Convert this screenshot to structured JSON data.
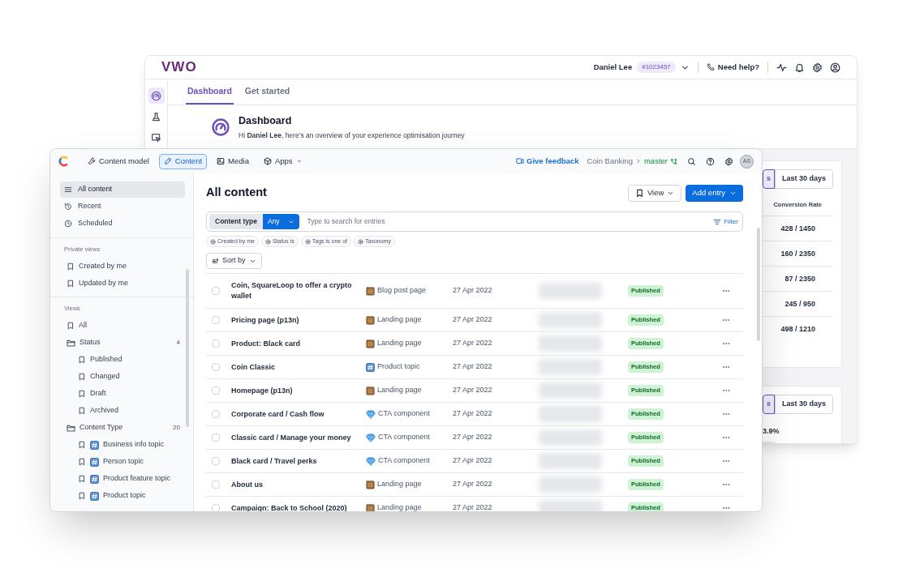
{
  "back_window": {
    "logo": "VWO",
    "header": {
      "user_name": "Daniel Lee",
      "account_id": "#1023457",
      "help": "Need help?"
    },
    "rail_items": [
      {
        "selected": true
      },
      {
        "selected": false
      },
      {
        "selected": false
      }
    ],
    "tabs": [
      {
        "label": "Dashboard",
        "selected": true
      },
      {
        "label": "Get started",
        "selected": false
      }
    ],
    "page_header": {
      "title": "Dashboard",
      "subtitle": "Hi **Daniel Lee**, here’s an overview of your experience optimisation journey"
    },
    "cards": [
      {
        "range_tabs": [
          {
            "label": "s",
            "selected": true
          },
          {
            "label": "Last 30 days",
            "selected": false
          }
        ],
        "column_header": "Conversion Rate",
        "values": [
          "428 / 1450",
          "160 / 2350",
          "87 / 2350",
          "245 / 950",
          "498 / 1210"
        ]
      },
      {
        "range_tabs": [
          {
            "label": "s",
            "selected": true
          },
          {
            "label": "Last 30 days",
            "selected": false
          }
        ],
        "values": [
          "3.9%"
        ]
      }
    ]
  },
  "front_window": {
    "nav": [
      {
        "label": "Content model",
        "selected": false,
        "has_menu": false
      },
      {
        "label": "Content",
        "selected": true,
        "has_menu": false
      },
      {
        "label": "Media",
        "selected": false,
        "has_menu": false
      },
      {
        "label": "Apps",
        "selected": false,
        "has_menu": true
      }
    ],
    "feedback": "Give feedback",
    "space": "Coin Banking",
    "environment": "master",
    "avatar_initials": "AS",
    "sidebar": {
      "top_items": [
        {
          "label": "All content",
          "selected": true
        },
        {
          "label": "Recent",
          "selected": false
        },
        {
          "label": "Scheduled",
          "selected": false
        }
      ],
      "sections": [
        {
          "heading": "Private views",
          "items": [
            {
              "label": "Created by me",
              "kind": "view"
            },
            {
              "label": "Updated by me",
              "kind": "view"
            }
          ]
        },
        {
          "heading": "Views",
          "items": [
            {
              "label": "All",
              "kind": "view"
            },
            {
              "label": "Status",
              "kind": "folder",
              "count": "4",
              "children": [
                {
                  "label": "Published",
                  "kind": "view"
                },
                {
                  "label": "Changed",
                  "kind": "view"
                },
                {
                  "label": "Draft",
                  "kind": "view"
                },
                {
                  "label": "Archived",
                  "kind": "view"
                }
              ]
            },
            {
              "label": "Content Type",
              "kind": "folder",
              "count": "20",
              "children": [
                {
                  "label": "Business info topic",
                  "kind": "type_view"
                },
                {
                  "label": "Person topic",
                  "kind": "type_view"
                },
                {
                  "label": "Product feature topic",
                  "kind": "type_view"
                },
                {
                  "label": "Product topic",
                  "kind": "type_view"
                }
              ]
            }
          ]
        }
      ]
    },
    "main": {
      "title": "All content",
      "view_button": "View",
      "add_button": "Add entry",
      "search": {
        "filter_label": "Content type",
        "filter_value": "Any",
        "placeholder": "Type to search for entries",
        "filter_button": "Filter"
      },
      "chips": [
        "Created by me",
        "Status is",
        "Tags is one of",
        "Taxonomy"
      ],
      "sort_button": "Sort by",
      "rows": [
        {
          "title": "Coin, SquareLoop to offer a crypto wallet",
          "kind": "page",
          "content_type": "Blog post page",
          "updated": "27 Apr 2022",
          "status": "Published",
          "checked": false
        },
        {
          "title": "Pricing page (p13n)",
          "kind": "page",
          "content_type": "Landing page",
          "updated": "27 Apr 2022",
          "status": "Published",
          "checked": false
        },
        {
          "title": "Product: Black card",
          "kind": "page",
          "content_type": "Landing page",
          "updated": "27 Apr 2022",
          "status": "Published",
          "checked": false
        },
        {
          "title": "Coin Classic",
          "kind": "topic",
          "content_type": "Product topic",
          "updated": "27 Apr 2022",
          "status": "Published",
          "checked": false
        },
        {
          "title": "Homepage (p13n)",
          "kind": "page",
          "content_type": "Landing page",
          "updated": "27 Apr 2022",
          "status": "Published",
          "checked": false
        },
        {
          "title": "Corporate card / Cash flow",
          "kind": "component",
          "content_type": "CTA component",
          "updated": "27 Apr 2022",
          "status": "Published",
          "checked": false
        },
        {
          "title": "Classic card / Manage your money",
          "kind": "component",
          "content_type": "CTA component",
          "updated": "27 Apr 2022",
          "status": "Published",
          "checked": false
        },
        {
          "title": "Black card / Travel perks",
          "kind": "component",
          "content_type": "CTA component",
          "updated": "27 Apr 2022",
          "status": "Published",
          "checked": false
        },
        {
          "title": "About us",
          "kind": "page",
          "content_type": "Landing page",
          "updated": "27 Apr 2022",
          "status": "Published",
          "checked": false
        },
        {
          "title": "Campaign: Back to School (2020)",
          "kind": "page",
          "content_type": "Landing page",
          "updated": "27 Apr 2022",
          "status": "Published",
          "checked": false
        }
      ]
    }
  }
}
